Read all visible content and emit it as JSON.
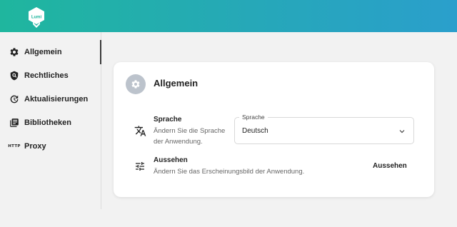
{
  "app": {
    "logo_text": "Lumi"
  },
  "sidebar": {
    "items": [
      {
        "label": "Allgemein",
        "icon": "gear-icon",
        "active": true
      },
      {
        "label": "Rechtliches",
        "icon": "shield-search-icon"
      },
      {
        "label": "Aktualisierungen",
        "icon": "update-icon"
      },
      {
        "label": "Bibliotheken",
        "icon": "library-icon"
      },
      {
        "label": "Proxy",
        "icon": "http-icon",
        "icon_text": "HTTP"
      }
    ]
  },
  "card": {
    "title": "Allgemein",
    "language": {
      "title": "Sprache",
      "desc_line1": "Ändern Sie die Sprache",
      "desc_line2": "der Anwendung.",
      "select_label": "Sprache",
      "select_value": "Deutsch"
    },
    "appearance": {
      "title": "Aussehen",
      "desc": "Ändern Sie das Erscheinungsbild der Anwendung.",
      "button_label": "Aussehen"
    }
  },
  "colors": {
    "header_gradient_start": "#1fb69e",
    "header_gradient_end": "#2a9fcc",
    "background": "#f2f2f2",
    "card": "#ffffff"
  }
}
